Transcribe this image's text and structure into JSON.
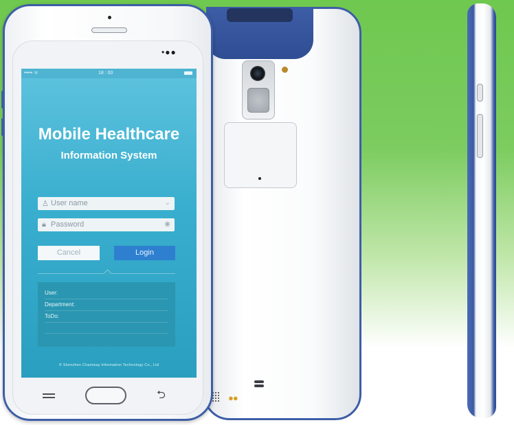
{
  "screen": {
    "statusbar": {
      "signal": "••••• ᯤ",
      "time": "18 : 00"
    },
    "title": "Mobile Healthcare",
    "subtitle": "Information System",
    "username_field": {
      "placeholder": "User name"
    },
    "password_field": {
      "placeholder": "Password"
    },
    "cancel_label": "Cancel",
    "login_label": "Login",
    "info": {
      "user_label": "User:",
      "department_label": "Department:",
      "todo_label": "ToDo:"
    },
    "copyright": "© Shenzhen Chainway Information Technology Co., Ltd"
  },
  "colors": {
    "background_green": "#6fc84f",
    "phone_blue": "#3d5da6",
    "screen_cyan": "#39aece",
    "login_button": "#2e7fd0"
  },
  "icons": [
    "user-icon",
    "lock-icon",
    "chevron-down-icon",
    "eye-icon",
    "menu-icon",
    "home-button",
    "back-icon"
  ]
}
